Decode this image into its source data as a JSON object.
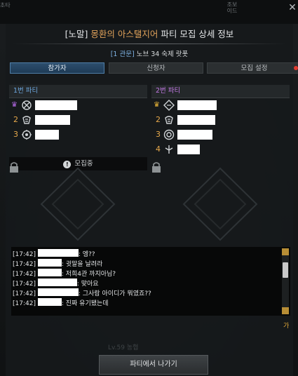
{
  "window": {
    "corner_left": "초타",
    "corner_right": "조보\n이드"
  },
  "dialog": {
    "title_prefix": "[노말]",
    "title_quest": "몽환의 아스탤지어",
    "title_suffix": "파티 모집 상세 정보",
    "subtitle_channel": "[1 관문]",
    "subtitle_text": "노브 34 숙제 랏폿"
  },
  "tabs": [
    {
      "label": "참가자",
      "active": true
    },
    {
      "label": "신청자",
      "active": false
    },
    {
      "label": "모집 설정",
      "active": false,
      "has_notification": true
    }
  ],
  "party1": {
    "header": "1번 파티",
    "members": [
      {
        "slot": "",
        "leader": true,
        "icon": "class-icon-a"
      },
      {
        "slot": "2",
        "leader": false,
        "icon": "class-icon-b"
      },
      {
        "slot": "3",
        "leader": false,
        "icon": "class-icon-c"
      }
    ],
    "recruiting_label": "모집중"
  },
  "party2": {
    "header": "2번 파티",
    "members": [
      {
        "slot": "",
        "leader": true,
        "icon": "class-icon-d"
      },
      {
        "slot": "2",
        "leader": false,
        "icon": "class-icon-b"
      },
      {
        "slot": "3",
        "leader": false,
        "icon": "class-icon-e"
      },
      {
        "slot": "4",
        "leader": false,
        "icon": "class-icon-f"
      }
    ]
  },
  "chat": {
    "lines": [
      {
        "time": "[17:42]",
        "text": ": 엥??"
      },
      {
        "time": "[17:42]",
        "text": ": 귓말을 날려라"
      },
      {
        "time": "[17:42]",
        "text": ": 저희4관 까지아님?"
      },
      {
        "time": "[17:42]",
        "text": ": 맞아요"
      },
      {
        "time": "[17:42]",
        "text": ": 그사람 아이디가 뭐였죠??"
      },
      {
        "time": "[17:42]",
        "text": ": 진짜 유기됐는데"
      }
    ],
    "lang_toggle": "가"
  },
  "background_text": {
    "entry_level": "Lv.59 농협"
  },
  "actions": {
    "leave_button": "파티에서 나가기"
  },
  "colors": {
    "quest_orange": "#e0a25a",
    "party1_blue": "#6ea8e0",
    "party2_purple": "#c47be6",
    "slot_gold": "#e7a94c",
    "active_tab_blue": "#2d4e6d"
  }
}
